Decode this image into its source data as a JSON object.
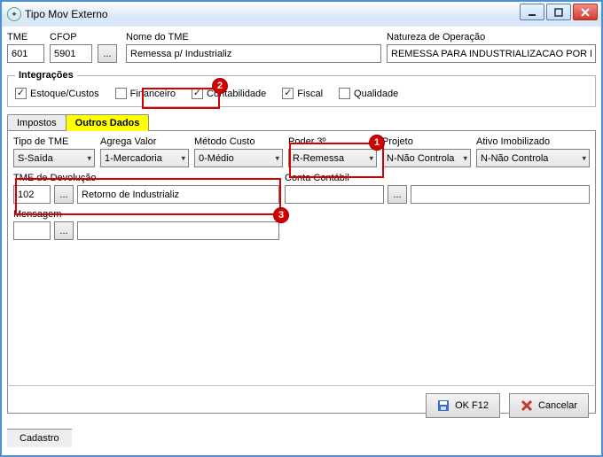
{
  "window": {
    "title": "Tipo Mov Externo"
  },
  "top": {
    "tme_label": "TME",
    "tme_value": "601",
    "cfop_label": "CFOP",
    "cfop_value": "5901",
    "cfop_ellipsis": "...",
    "nome_label": "Nome do TME",
    "nome_value": "Remessa p/ Industrializ",
    "natureza_label": "Natureza de Operação",
    "natureza_value": "REMESSA PARA INDUSTRIALIZACAO POR ENC"
  },
  "integ": {
    "legend": "Integrações",
    "items": [
      {
        "label": "Estoque/Custos",
        "checked": true
      },
      {
        "label": "Financeiro",
        "checked": false
      },
      {
        "label": "Contabilidade",
        "checked": true
      },
      {
        "label": "Fiscal",
        "checked": true
      },
      {
        "label": "Qualidade",
        "checked": false
      }
    ]
  },
  "tabs": {
    "impostos": "Impostos",
    "outros": "Outros Dados"
  },
  "outros": {
    "tipo_label": "Tipo de TME",
    "tipo_value": "S-Saída",
    "agrega_label": "Agrega Valor",
    "agrega_value": "1-Mercadoria",
    "metodo_label": "Método Custo",
    "metodo_value": "0-Médio",
    "poder_label": "Poder 3º",
    "poder_value": "R-Remessa",
    "projeto_label": "Projeto",
    "projeto_value": "N-Não Controla",
    "ativo_label": "Ativo Imobilizado",
    "ativo_value": "N-Não Controla",
    "devol_label": "TME de Devolução",
    "devol_code": "102",
    "devol_ellipsis": "...",
    "devol_desc": "Retorno de Industrializ",
    "conta_label": "Conta Contábil",
    "conta_val": "",
    "conta_ellipsis": "...",
    "conta_desc": "",
    "msg_label": "Mensagem",
    "msg_code": "",
    "msg_ellipsis": "...",
    "msg_desc": ""
  },
  "footer": {
    "ok": "OK F12",
    "cancel": "Cancelar",
    "cadastro": "Cadastro"
  },
  "annot": {
    "b1": "1",
    "b2": "2",
    "b3": "3"
  }
}
